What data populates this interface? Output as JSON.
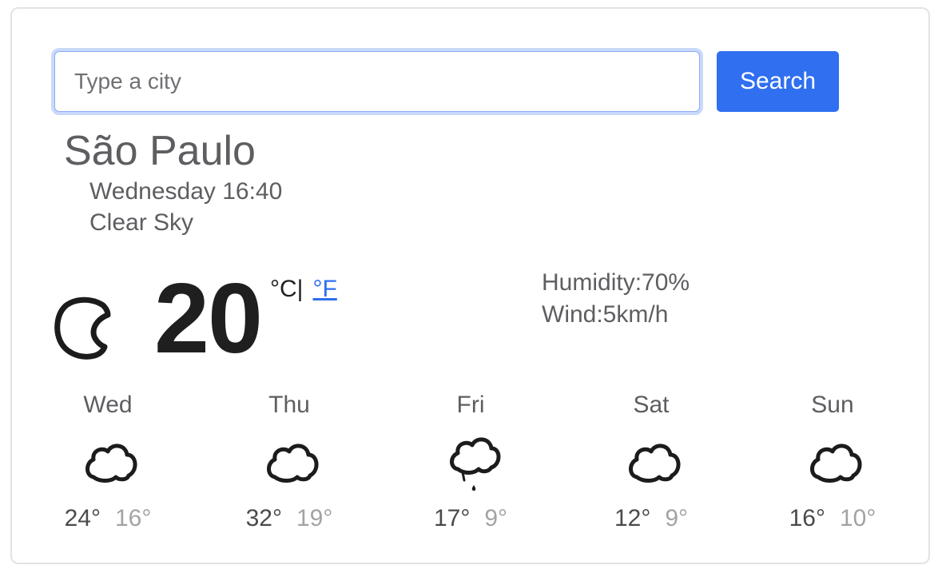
{
  "search": {
    "placeholder": "Type a city",
    "value": "",
    "button_label": "Search"
  },
  "current": {
    "city": "São Paulo",
    "datetime": "Wednesday 16:40",
    "condition": "Clear Sky",
    "icon": "moon-icon",
    "temperature": "20",
    "unit_celsius": "°C",
    "unit_separator": "|",
    "unit_fahrenheit": "°F",
    "humidity": "Humidity:70%",
    "wind": "Wind:5km/h"
  },
  "forecast": [
    {
      "day": "Wed",
      "icon": "cloud-icon",
      "high": "24°",
      "low": "16°"
    },
    {
      "day": "Thu",
      "icon": "cloud-icon",
      "high": "32°",
      "low": "19°"
    },
    {
      "day": "Fri",
      "icon": "rain-cloud-icon",
      "high": "17°",
      "low": "9°"
    },
    {
      "day": "Sat",
      "icon": "cloud-icon",
      "high": "12°",
      "low": "9°"
    },
    {
      "day": "Sun",
      "icon": "cloud-icon",
      "high": "16°",
      "low": "10°"
    }
  ],
  "colors": {
    "accent": "#2f6ff0",
    "text": "#5e5e62",
    "temp": "#1f1f1f",
    "low_temp": "#a3a3a6"
  }
}
